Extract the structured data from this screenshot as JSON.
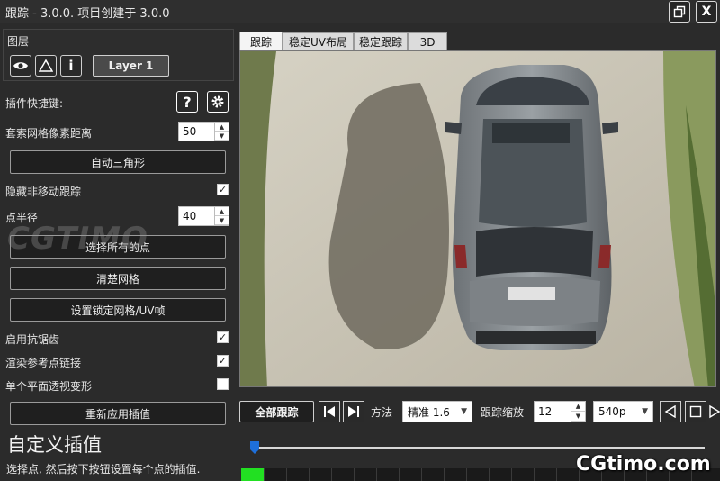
{
  "window": {
    "title": "跟踪  -  3.0.0. 项目创建于 3.0.0",
    "close_label": "X"
  },
  "layers": {
    "section_label": "图层",
    "layer_button": "Layer 1"
  },
  "options": {
    "plugin_shortcut_label": "插件快捷键:",
    "search_grid_label": "套索网格像素距离",
    "search_grid_value": "50",
    "auto_triangle_button": "自动三角形",
    "hide_nonmoving_label": "隐藏非移动跟踪",
    "hide_nonmoving_checked": true,
    "point_radius_label": "点半径",
    "point_radius_value": "40",
    "select_all_button": "选择所有的点",
    "clear_grid_button": "清楚网格",
    "set_lock_button": "设置锁定网格/UV帧",
    "antialias_label": "启用抗锯齿",
    "antialias_checked": true,
    "render_ref_label": "渲染参考点链接",
    "render_ref_checked": true,
    "single_plane_label": "单个平面透视变形",
    "single_plane_checked": false,
    "reapply_button": "重新应用插值"
  },
  "custom_interp": {
    "title": "自定义插值",
    "description": "选择点, 然后按下按钮设置每个点的插值."
  },
  "tabs": [
    {
      "label": "跟踪",
      "active": true
    },
    {
      "label": "稳定UV布局",
      "active": false
    },
    {
      "label": "稳定跟踪",
      "active": false
    },
    {
      "label": "3D",
      "active": false
    }
  ],
  "toolbar": {
    "track_all_button": "全部跟踪",
    "method_label": "方法",
    "method_value": "精准 1.6",
    "track_scale_label": "跟踪缩放",
    "track_scale_value": "12",
    "resolution_value": "540p"
  },
  "watermarks": {
    "left": "CGTIMO",
    "right": "CGtimo.com"
  },
  "colors": {
    "accent_green": "#22e022",
    "playhead_blue": "#1e6fd9"
  },
  "timeline": {
    "playhead_fraction": 0.0
  }
}
